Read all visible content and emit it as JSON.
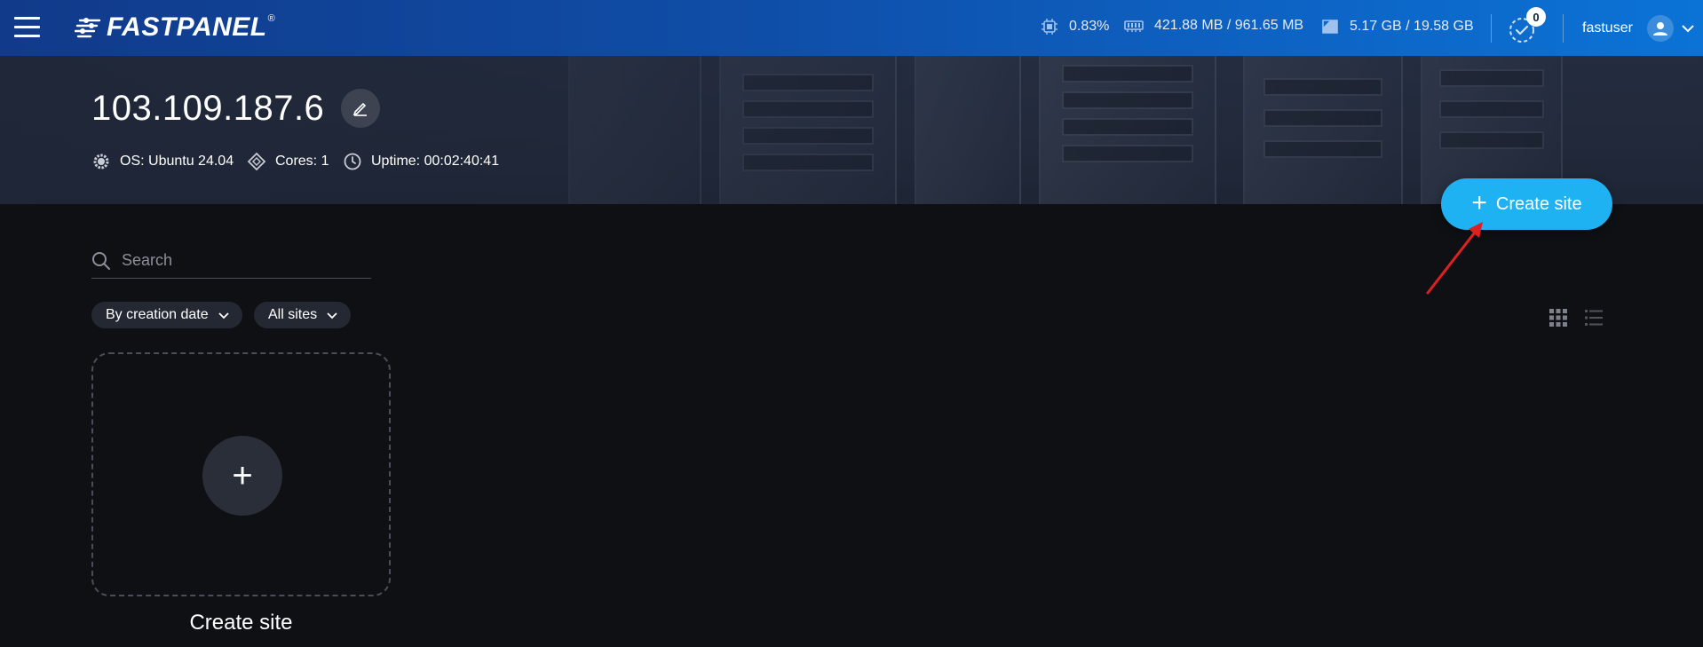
{
  "app": {
    "brand": "FASTPANEL",
    "registered_mark": "®"
  },
  "topbar": {
    "cpu": "0.83%",
    "memory": "421.88 MB / 961.65 MB",
    "disk": "5.17 GB / 19.58 GB",
    "tasks_count": "0",
    "username": "fastuser"
  },
  "server": {
    "ip": "103.109.187.6",
    "os": "OS: Ubuntu 24.04",
    "cores": "Cores: 1",
    "uptime": "Uptime: 00:02:40:41"
  },
  "actions": {
    "create_site_label": "Create site"
  },
  "search": {
    "placeholder": "Search",
    "value": ""
  },
  "filters": {
    "sort_label": "By creation date",
    "scope_label": "All sites"
  },
  "card": {
    "label": "Create site"
  },
  "colors": {
    "accent": "#1fb2f3",
    "topbar_start": "#113a8a",
    "topbar_end": "#0b73d6",
    "background": "#0f1014",
    "annotation_arrow": "#e02020"
  },
  "icons": [
    "menu-icon",
    "cpu-icon",
    "memory-icon",
    "disk-icon",
    "tasks-icon",
    "user-icon",
    "chevron-down-icon",
    "edit-icon",
    "os-icon",
    "cores-icon",
    "clock-icon",
    "plus-icon",
    "search-icon",
    "grid-view-icon",
    "list-view-icon"
  ]
}
